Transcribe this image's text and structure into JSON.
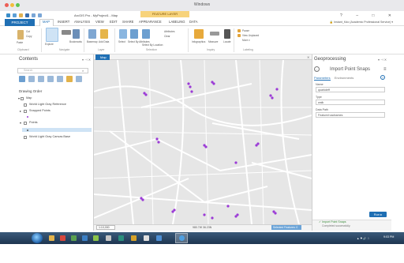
{
  "os": {
    "title": "Windows"
  },
  "app": {
    "title": "ArcGIS Pro - MyProject1 - Map",
    "contextual_tab": "FEATURE LAYER",
    "window_controls": "?  –  □  ✕",
    "user": "🔒 Instant_Kdo (Academic Professional Service) ▾"
  },
  "tabs": [
    {
      "label": "PROJECT"
    },
    {
      "label": "MAP"
    },
    {
      "label": "INSERT"
    },
    {
      "label": "ANALYSIS"
    },
    {
      "label": "VIEW"
    },
    {
      "label": "EDIT"
    },
    {
      "label": "SHARE"
    },
    {
      "label": "APPEARANCE"
    },
    {
      "label": "LABELING"
    },
    {
      "label": "DATA"
    }
  ],
  "ribbon": {
    "cut": "Cut",
    "copy": "Copy",
    "paste": "Paste",
    "explore": "Explore",
    "bookmarks": "Bookmarks",
    "basemap": "Basemap",
    "add_data": "Add Data",
    "select": "Select",
    "select_by_attributes": "Select By Attributes",
    "select_by_location": "Select By Location",
    "attributes": "Attributes",
    "clear": "Clear",
    "infographics": "Infographics",
    "measure": "Measure",
    "locate": "Locate",
    "pause": "Pause",
    "view_unplaced": "View Unplaced",
    "more": "More ▾",
    "groups": [
      "Clipboard",
      "Navigate",
      "Layer",
      "Selection",
      "Inquiry",
      "Labeling"
    ]
  },
  "contents": {
    "title": "Contents",
    "controls": "▾ ⊣ ✕",
    "search_placeholder": "Search",
    "heading": "Drawing Order",
    "items": [
      {
        "label": "Map"
      },
      {
        "label": "World Light Gray Reference"
      },
      {
        "label": "Snapped Points"
      },
      {
        "label": "Points"
      },
      {
        "label": "World Light Gray Canvas Base"
      }
    ]
  },
  "map": {
    "tab_label": "Map",
    "close": "✕",
    "scale": "1:10,000",
    "coordinates": "980.7W 36.23N",
    "selected_features": "Selected Features: 0",
    "water_color": "#cfd7e3",
    "road_color": "#ffffff",
    "point_color": "#9b3ad6"
  },
  "geoprocessing": {
    "title": "Geoprocessing",
    "controls": "▾ ⊣ ✕",
    "tool_name": "Import Point Snaps",
    "tabs": [
      "Parameters",
      "Environments"
    ],
    "help": "?",
    "params": [
      {
        "label": "Name",
        "value": "quarkdeff"
      },
      {
        "label": "Type",
        "value": "walk"
      },
      {
        "label": "Data Path",
        "value": "Feature/roadnames"
      }
    ],
    "run_label": "Run ▸",
    "status_title": "✓ Import Point Snaps",
    "status_detail": "Completed successfully."
  },
  "taskbar": {
    "tray": "▲ ⚑ 🔊 ⎍",
    "clock": "9:03 PM"
  }
}
